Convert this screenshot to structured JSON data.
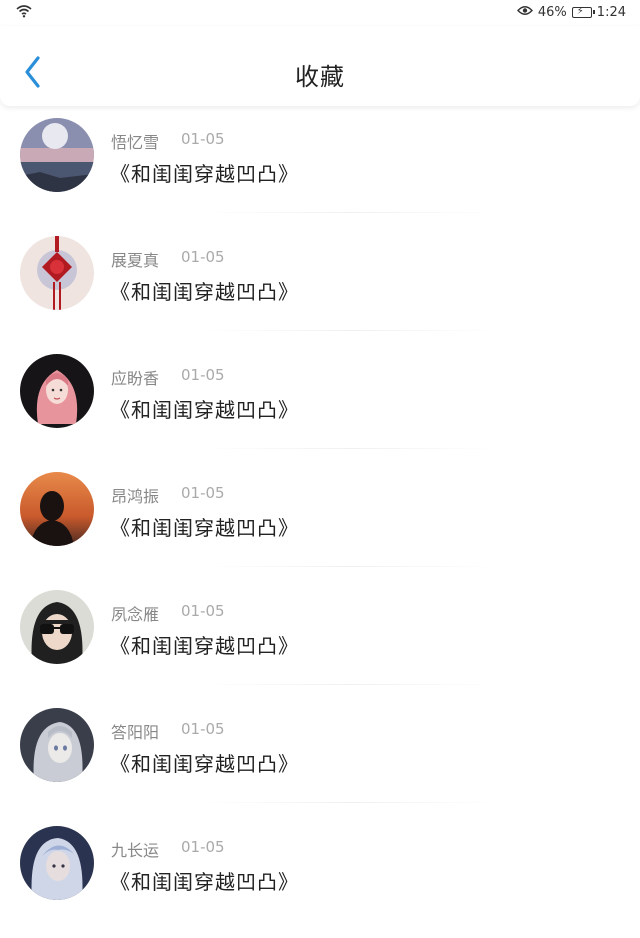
{
  "status_bar": {
    "battery_percent": "46%",
    "time": "1:24"
  },
  "header": {
    "title": "收藏"
  },
  "favorites": [
    {
      "name": "悟忆雪",
      "date": "01-05",
      "title": "《和闺闺穿越凹凸》",
      "avatar_icon": "moon-lake-avatar"
    },
    {
      "name": "展夏真",
      "date": "01-05",
      "title": "《和闺闺穿越凹凸》",
      "avatar_icon": "chinese-knot-avatar"
    },
    {
      "name": "应盼香",
      "date": "01-05",
      "title": "《和闺闺穿越凹凸》",
      "avatar_icon": "pink-hair-girl-avatar"
    },
    {
      "name": "昂鸿振",
      "date": "01-05",
      "title": "《和闺闺穿越凹凸》",
      "avatar_icon": "sunset-silhouette-avatar"
    },
    {
      "name": "夙念雁",
      "date": "01-05",
      "title": "《和闺闺穿越凹凸》",
      "avatar_icon": "sunglasses-girl-avatar"
    },
    {
      "name": "答阳阳",
      "date": "01-05",
      "title": "《和闺闺穿越凹凸》",
      "avatar_icon": "anime-character-avatar"
    },
    {
      "name": "九长运",
      "date": "01-05",
      "title": "《和闺闺穿越凹凸》",
      "avatar_icon": "blue-hair-character-avatar"
    }
  ]
}
